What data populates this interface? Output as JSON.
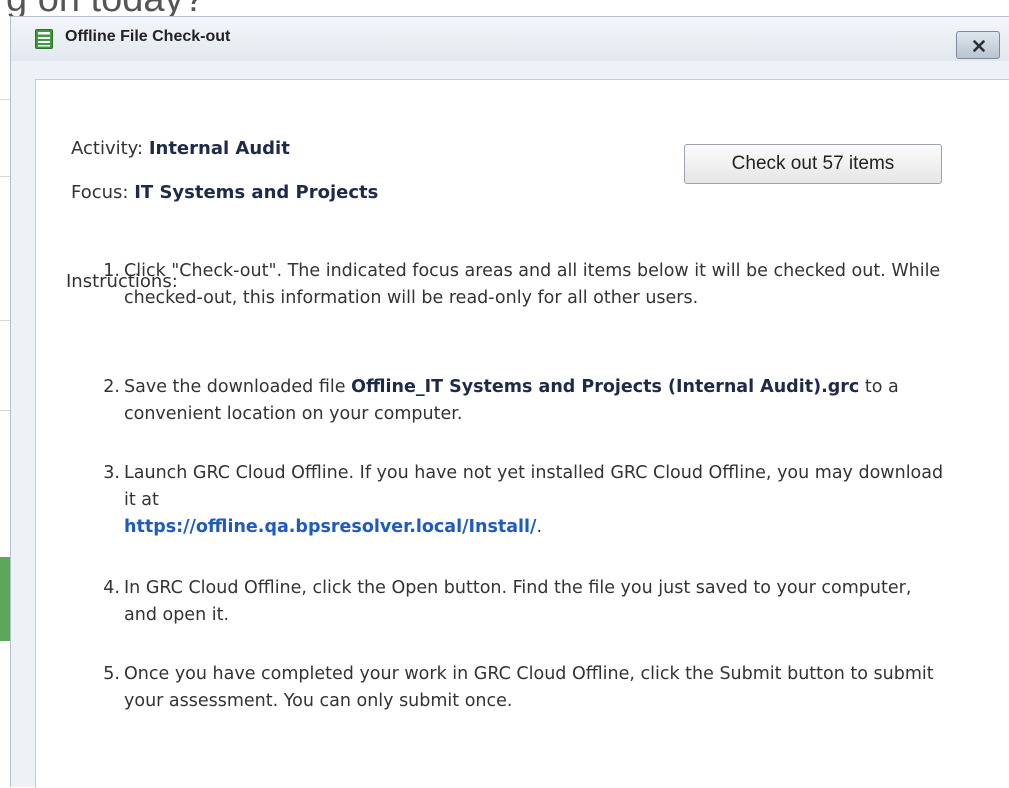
{
  "background": {
    "heading_fragment": "g on today?"
  },
  "dialog": {
    "title": "Offline File Check-out",
    "close_label": "x",
    "activity_label": "Activity:",
    "activity_value": "Internal Audit",
    "focus_label": "Focus:",
    "focus_value": "IT Systems and Projects",
    "checkout_button": "Check out 57 items",
    "instructions_label": "Instructions:",
    "steps": [
      {
        "number": "1.",
        "text": "Click \"Check-out\". The indicated focus areas and all items below it will be checked out. While checked-out, this information will be read-only for all other users."
      },
      {
        "number": "2.",
        "text_before": "Save the downloaded file ",
        "filename": "Offline_IT Systems and Projects (Internal Audit).grc",
        "text_after": " to a convenient location on your computer."
      },
      {
        "number": "3.",
        "text_before": "Launch GRC Cloud Offline. If you have not yet installed GRC Cloud Offline, you may download it at ",
        "link": "https://offline.qa.bpsresolver.local/Install/",
        "text_after": "."
      },
      {
        "number": "4.",
        "text": "In GRC Cloud Offline, click the Open button. Find the file you just saved to your computer, and open it."
      },
      {
        "number": "5.",
        "text": "Once you have completed your work in GRC Cloud Offline, click the Submit button to submit your assessment. You can only submit once."
      }
    ]
  },
  "colors": {
    "title_bar": "#e2e8ef",
    "link": "#1f5bbf",
    "bold_text": "#1d2a4a"
  },
  "icons": {
    "title_icon": "document-list-icon",
    "close_icon": "close-icon"
  }
}
